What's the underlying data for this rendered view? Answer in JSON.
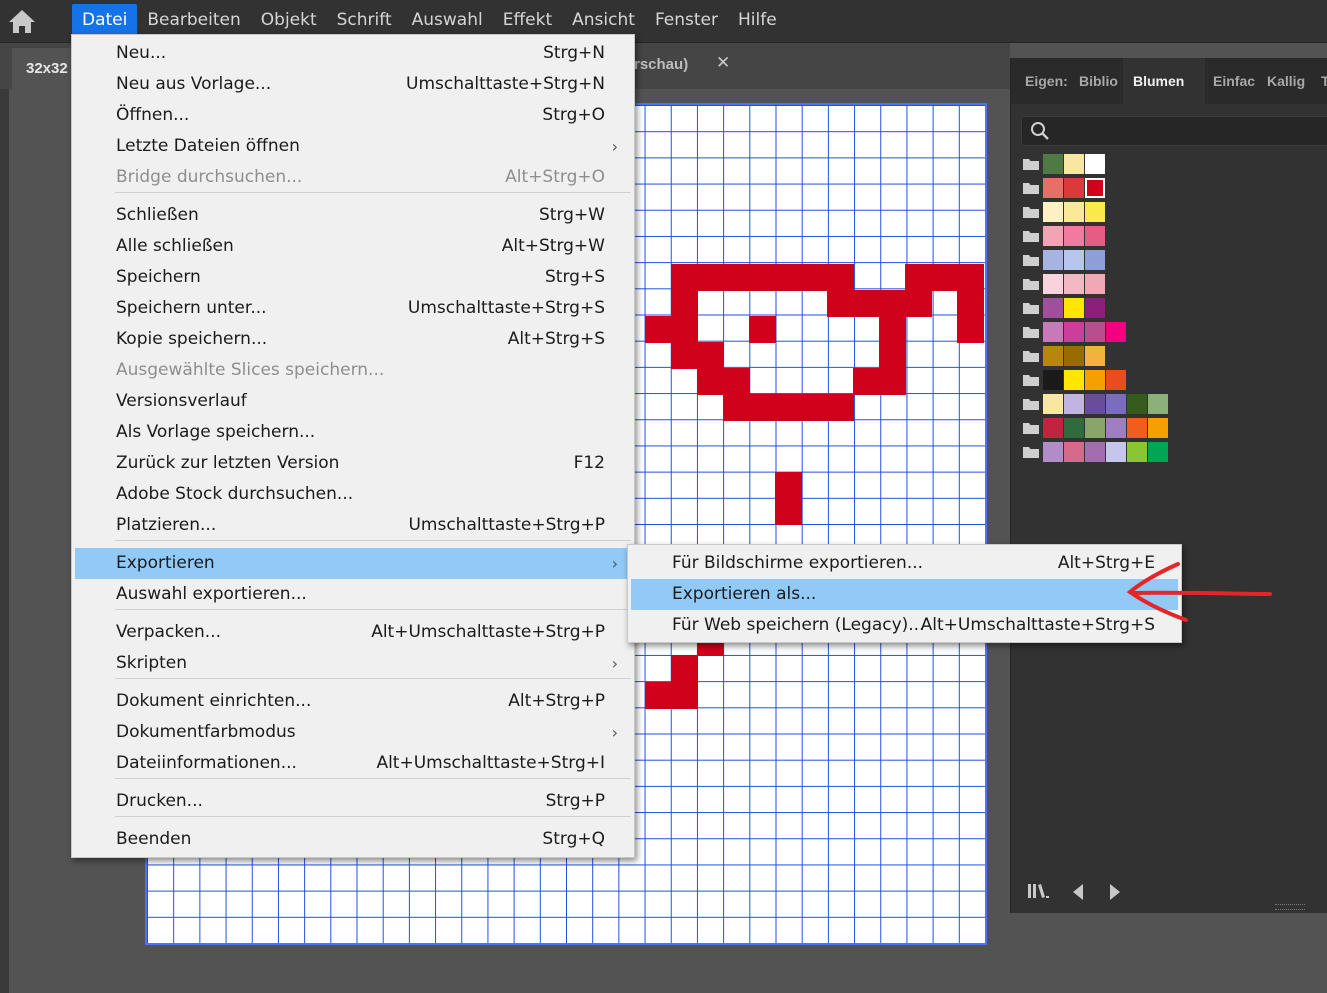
{
  "menubar": {
    "items": [
      {
        "label": "Datei",
        "active": true
      },
      {
        "label": "Bearbeiten"
      },
      {
        "label": "Objekt"
      },
      {
        "label": "Schrift"
      },
      {
        "label": "Auswahl"
      },
      {
        "label": "Effekt"
      },
      {
        "label": "Ansicht"
      },
      {
        "label": "Fenster"
      },
      {
        "label": "Hilfe"
      }
    ],
    "home_icon": "home-icon"
  },
  "tabs": {
    "main_title": "32x32",
    "second_title_visible": "rschau)",
    "close_glyph": "✕"
  },
  "file_menu": {
    "items": [
      {
        "label": "Neu...",
        "shortcut": "Strg+N"
      },
      {
        "label": "Neu aus Vorlage...",
        "shortcut": "Umschalttaste+Strg+N"
      },
      {
        "label": "Öffnen...",
        "shortcut": "Strg+O"
      },
      {
        "label": "Letzte Dateien öffnen",
        "shortcut": "",
        "submenu": true
      },
      {
        "label": "Bridge durchsuchen...",
        "shortcut": "Alt+Strg+O",
        "disabled": true
      },
      {
        "label": "Schließen",
        "shortcut": "Strg+W"
      },
      {
        "label": "Alle schließen",
        "shortcut": "Alt+Strg+W"
      },
      {
        "label": "Speichern",
        "shortcut": "Strg+S"
      },
      {
        "label": "Speichern unter...",
        "shortcut": "Umschalttaste+Strg+S"
      },
      {
        "label": "Kopie speichern...",
        "shortcut": "Alt+Strg+S"
      },
      {
        "label": "Ausgewählte Slices speichern...",
        "shortcut": "",
        "disabled": true
      },
      {
        "label": "Versionsverlauf",
        "shortcut": ""
      },
      {
        "label": "Als Vorlage speichern...",
        "shortcut": ""
      },
      {
        "label": "Zurück zur letzten Version",
        "shortcut": "F12"
      },
      {
        "label": "Adobe Stock durchsuchen...",
        "shortcut": ""
      },
      {
        "label": "Platzieren...",
        "shortcut": "Umschalttaste+Strg+P"
      },
      {
        "label": "Exportieren",
        "shortcut": "",
        "submenu": true,
        "highlighted": true
      },
      {
        "label": "Auswahl exportieren...",
        "shortcut": ""
      },
      {
        "label": "Verpacken...",
        "shortcut": "Alt+Umschalttaste+Strg+P"
      },
      {
        "label": "Skripten",
        "shortcut": "",
        "submenu": true
      },
      {
        "label": "Dokument einrichten...",
        "shortcut": "Alt+Strg+P"
      },
      {
        "label": "Dokumentfarbmodus",
        "shortcut": "",
        "submenu": true
      },
      {
        "label": "Dateiinformationen...",
        "shortcut": "Alt+Umschalttaste+Strg+I"
      },
      {
        "label": "Drucken...",
        "shortcut": "Strg+P"
      },
      {
        "label": "Beenden",
        "shortcut": "Strg+Q"
      }
    ],
    "submenu_arrow": "›"
  },
  "export_submenu": {
    "items": [
      {
        "label": "Für Bildschirme exportieren...",
        "shortcut": "Alt+Strg+E"
      },
      {
        "label": "Exportieren als...",
        "shortcut": "",
        "highlighted": true
      },
      {
        "label": "Für Web speichern (Legacy)...",
        "shortcut": "Alt+Umschalttaste+Strg+S"
      }
    ]
  },
  "panel": {
    "tabs": [
      {
        "label": "Eigen:"
      },
      {
        "label": "Biblio"
      },
      {
        "label": "Blumen",
        "active": true
      },
      {
        "label": "Einfac"
      },
      {
        "label": "Kallig"
      },
      {
        "label": "T"
      }
    ],
    "search_icon": "search-icon",
    "swatch_groups": [
      [
        "#4f7a45",
        "#f7e7a0",
        "#ffffff"
      ],
      [
        "#e86f66",
        "#dc3a3a",
        "#d0021b"
      ],
      [
        "#fdf1c4",
        "#fbe99a",
        "#f9e94b"
      ],
      [
        "#f4a3b4",
        "#f07aa0",
        "#e65c84"
      ],
      [
        "#a7b3e2",
        "#b8c6ee",
        "#8e9fd8"
      ],
      [
        "#f8d2dc",
        "#f4b8c2",
        "#f2a8b4"
      ],
      [
        "#a24e9e",
        "#ffe600",
        "#8b1f7a"
      ],
      [
        "#c87ab8",
        "#cc3e9a",
        "#b84f8c",
        "#f2007f"
      ],
      [
        "#b8860b",
        "#9a6b00",
        "#f2b33d"
      ],
      [
        "#1a1a1a",
        "#ffe600",
        "#f59f00",
        "#ea4c1d"
      ],
      [
        "#f7e7a0",
        "#c1b4e2",
        "#6a4c9c",
        "#7a6dc0",
        "#375a1d",
        "#8ab17a"
      ],
      [
        "#c2243f",
        "#2f6b3b",
        "#8aa56a",
        "#a07ec2",
        "#f25c1d",
        "#f59f00"
      ],
      [
        "#b08cc8",
        "#d66a8a",
        "#a26eaf",
        "#c6c6ec",
        "#8ac634",
        "#00a651"
      ]
    ],
    "footer_icons": [
      "library-icon",
      "prev-icon",
      "next-icon"
    ]
  },
  "canvas": {
    "grid": "32x32",
    "pixel_color": "#d0021b"
  }
}
